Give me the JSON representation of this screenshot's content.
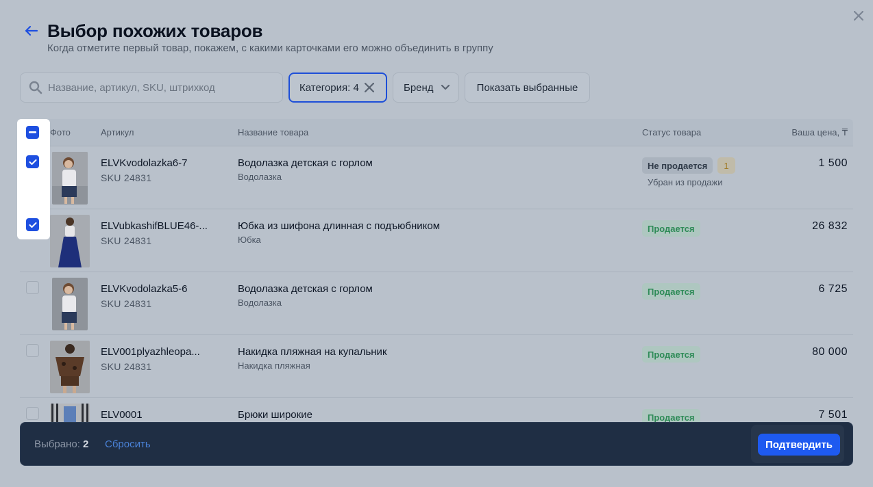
{
  "header": {
    "title": "Выбор похожих товаров",
    "subtitle": "Когда отметите первый товар, покажем, с какими карточками его можно объединить в группу"
  },
  "filters": {
    "search_placeholder": "Название, артикул, SKU, штрихкод",
    "category_label": "Категория: 4",
    "brand_label": "Бренд",
    "show_selected_label": "Показать выбранные"
  },
  "table": {
    "columns": {
      "photo": "Фото",
      "article": "Артикул",
      "name": "Название товара",
      "status": "Статус товара",
      "price": "Ваша цена, ₸"
    },
    "rows": [
      {
        "checked": true,
        "article": "ELVKvodolazka6-7",
        "sku": "SKU 24831",
        "name": "Водолазка детская с горлом",
        "category": "Водолазка",
        "status": "Не продается",
        "status_badge": "1",
        "substatus": "Убран из продажи",
        "price": "1 500"
      },
      {
        "checked": true,
        "article": "ELVubkashifBLUE46-...",
        "sku": "SKU 24831",
        "name": "Юбка из шифона длинная с подъюбником",
        "category": "Юбка",
        "status": "Продается",
        "price": "26 832"
      },
      {
        "checked": false,
        "article": "ELVKvodolazka5-6",
        "sku": "SKU 24831",
        "name": "Водолазка детская с горлом",
        "category": "Водолазка",
        "status": "Продается",
        "price": "6 725"
      },
      {
        "checked": false,
        "article": "ELV001plyazhleopa...",
        "sku": "SKU 24831",
        "name": "Накидка пляжная на купальник",
        "category": "Накидка пляжная",
        "status": "Продается",
        "price": "80 000"
      },
      {
        "checked": false,
        "article": "ELV0001",
        "sku": "",
        "name": "Брюки широкие",
        "category": "",
        "status": "Продается",
        "price": "7 501"
      }
    ]
  },
  "footer": {
    "selected_label": "Выбрано:",
    "selected_count": "2",
    "reset_label": "Сбросить",
    "confirm_label": "Подтвердить"
  },
  "colors": {
    "accent": "#1e4fe0",
    "footer_bg": "#1f2e44",
    "status_green": "#2e8b57",
    "overlay": "#b9c1cb"
  },
  "icons": [
    "close-icon",
    "back-arrow-icon",
    "search-icon",
    "clear-icon",
    "chevron-down-icon",
    "checkmark-icon",
    "minus-icon"
  ]
}
